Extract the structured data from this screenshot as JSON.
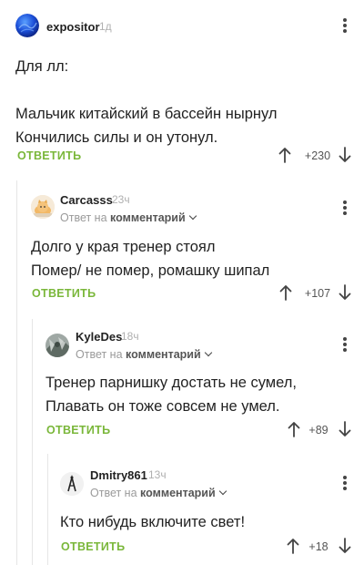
{
  "comments": [
    {
      "username": "expositor",
      "age": "1д",
      "text_lines": [
        "Для лл:",
        "",
        "Мальчик китайский в бассейн нырнул",
        "Кончились силы и он утонул."
      ],
      "reply_label": "ОТВЕТИТЬ",
      "score": "+230"
    },
    {
      "username": "Carcasss",
      "age": "23ч",
      "reply_to_prefix": "Ответ на",
      "reply_to_target": "комментарий",
      "text_lines": [
        "Долго у края тренер стоял",
        "Помер/ не помер,  ромашку шипал"
      ],
      "reply_label": "ОТВЕТИТЬ",
      "score": "+107"
    },
    {
      "username": "KyleDes",
      "age": "18ч",
      "reply_to_prefix": "Ответ на",
      "reply_to_target": "комментарий",
      "text_lines": [
        "Тренер парнишку достать не сумел,",
        "Плавать он тоже совсем не умел."
      ],
      "reply_label": "ОТВЕТИТЬ",
      "score": "+89"
    },
    {
      "username": "Dmitry861",
      "age": "13ч",
      "reply_to_prefix": "Ответ на",
      "reply_to_target": "комментарий",
      "text_lines": [
        "Кто нибудь включите свет!"
      ],
      "reply_label": "ОТВЕТИТЬ",
      "score": "+18"
    }
  ],
  "colors": {
    "reply_accent": "#7ab73a",
    "text": "#222222",
    "muted": "#9a9a9a",
    "thread_line": "#e6e6e6"
  },
  "icons": {
    "avatar_1": "blue-sphere-avatar",
    "avatar_2": "cat-avatar",
    "avatar_3": "photo-avatar",
    "avatar_4": "sketch-avatar",
    "vote_up": "arrow-up-icon",
    "vote_down": "arrow-down-icon",
    "menu": "kebab-menu-icon"
  }
}
